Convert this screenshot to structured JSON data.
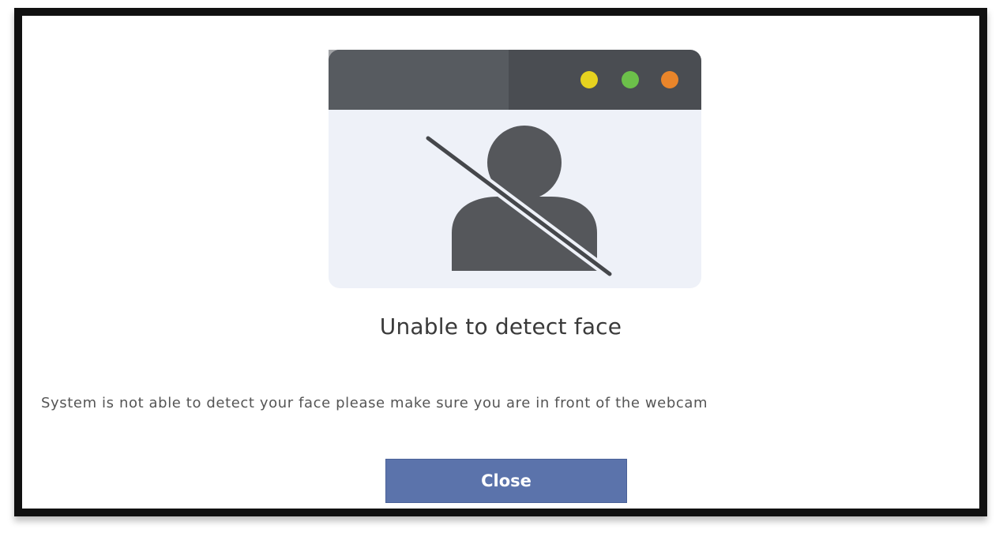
{
  "dialog": {
    "title": "Unable to detect face",
    "message": "System is not able to detect your face please make sure you are in front of the webcam",
    "close_label": "Close",
    "illustration": {
      "icon": "no-face-detected-icon",
      "window_dots": [
        "#e6d21f",
        "#6cc04a",
        "#e9852a"
      ],
      "titlebar_color": "#4a4d52",
      "panel_color": "#eef1f8",
      "silhouette_color": "#55575b"
    },
    "button_color": "#5b73ab"
  }
}
